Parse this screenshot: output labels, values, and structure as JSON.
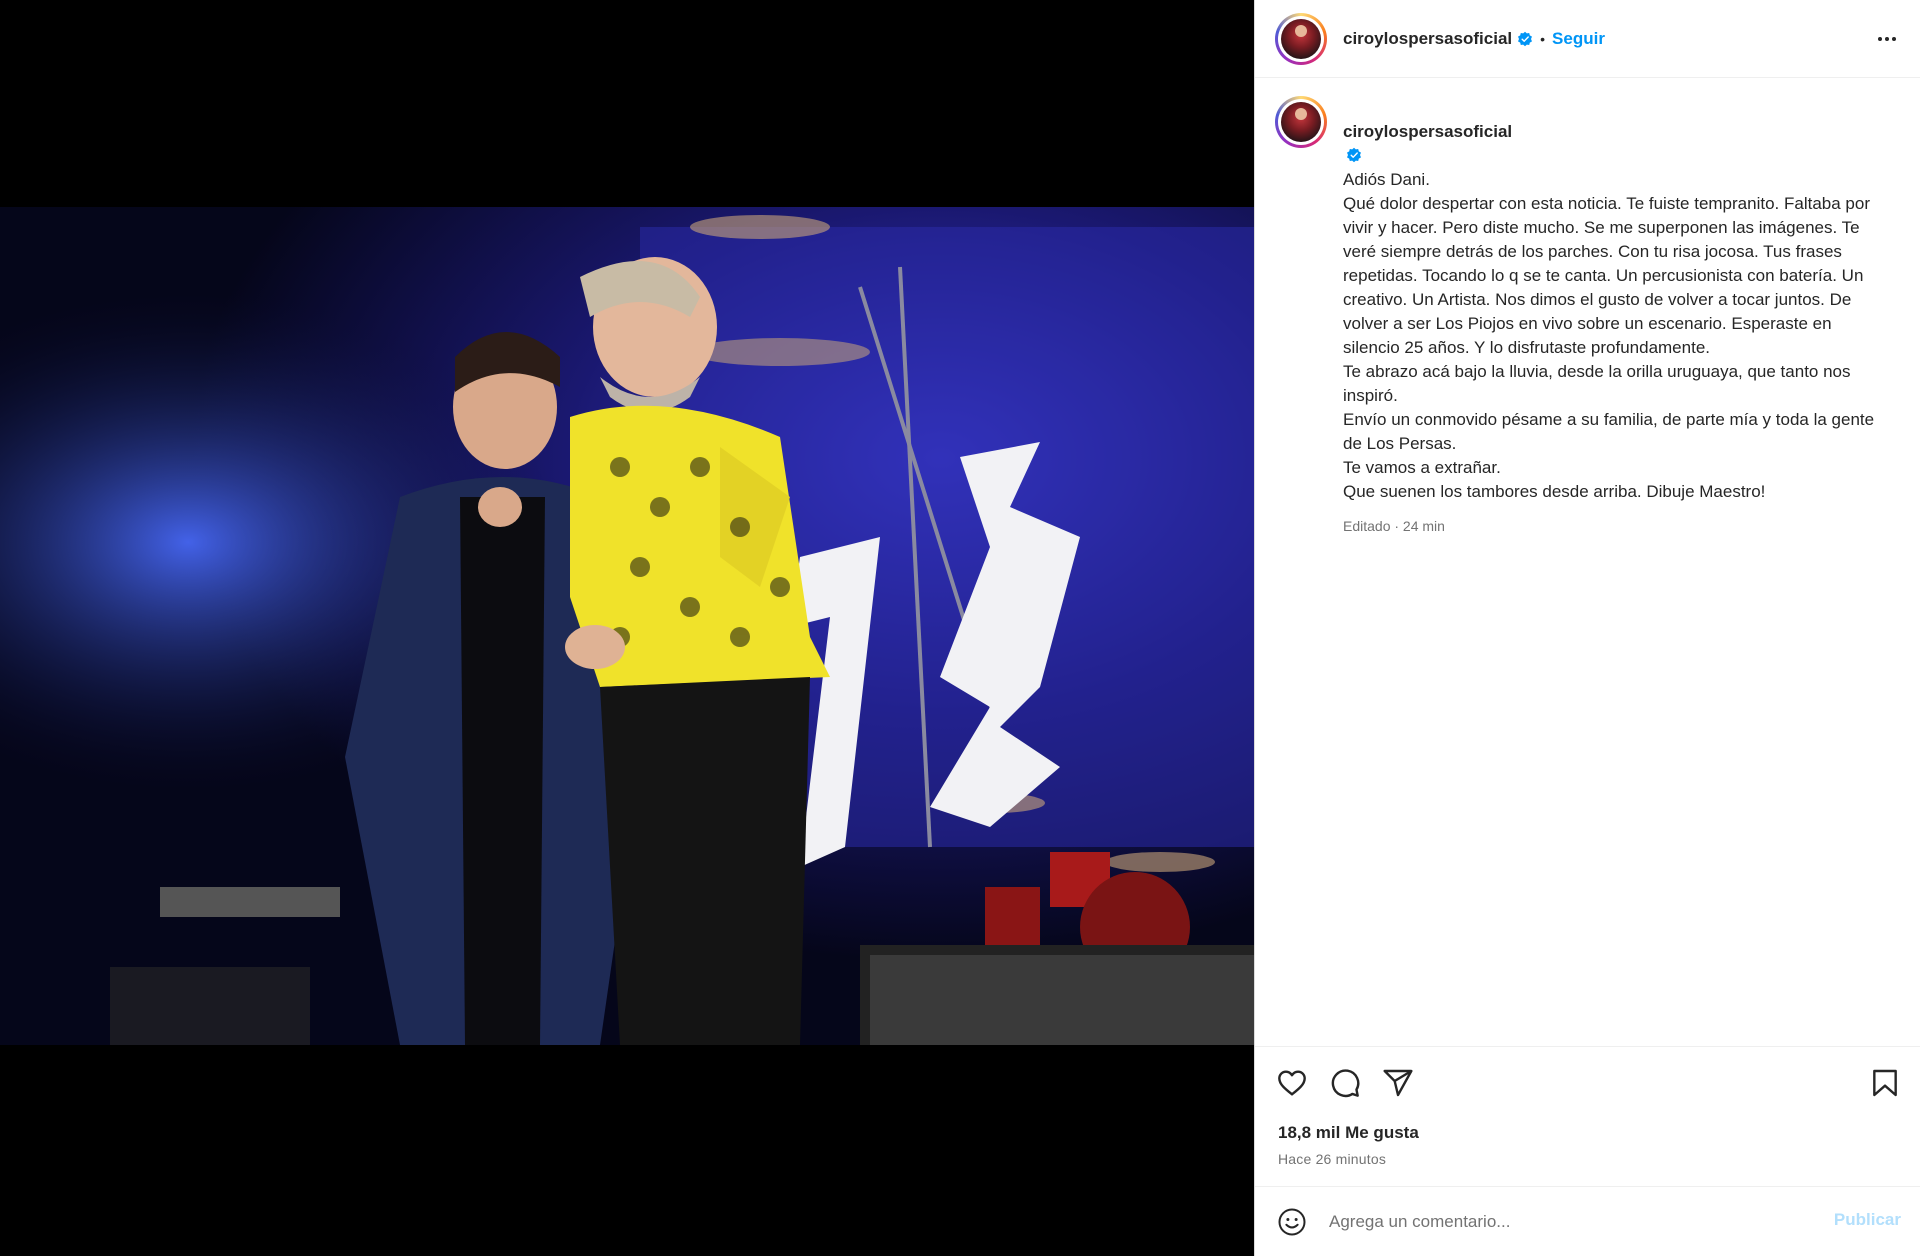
{
  "post": {
    "username": "ciroylospersasoficial",
    "follow_label": "Seguir",
    "separator": "•"
  },
  "caption": {
    "username": "ciroylospersasoficial",
    "text": "Adiós Dani.\nQué dolor despertar con esta noticia. Te fuiste tempranito. Faltaba por vivir y hacer. Pero diste mucho. Se me superponen las imágenes. Te veré siempre detrás de los parches. Con tu risa jocosa. Tus frases repetidas. Tocando lo q se te canta. Un percusionista con batería. Un creativo. Un Artista. Nos dimos el gusto de volver a tocar juntos. De volver a ser Los Piojos en vivo sobre un escenario. Esperaste en silencio 25 años. Y lo disfrutaste profundamente.\nTe abrazo acá bajo la lluvia, desde la orilla uruguaya, que tanto nos inspiró.\nEnvío un conmovido pésame a su familia, de parte mía y toda la gente de Los Persas.\nTe vamos a extrañar.\nQue suenen los tambores desde arriba. Dibuje Maestro!",
    "meta": "Editado · 24 min"
  },
  "stats": {
    "likes": "18,8 mil Me gusta",
    "time": "Hace 26 minutos"
  },
  "comment": {
    "placeholder": "Agrega un comentario...",
    "publish_label": "Publicar"
  },
  "icons": {
    "more": "more-options-icon",
    "like": "heart-icon",
    "comment": "comment-icon",
    "share": "share-icon",
    "save": "bookmark-icon",
    "emoji": "emoji-icon",
    "verified": "verified-badge-icon"
  },
  "colors": {
    "accent": "#0095f6",
    "publish_disabled": "#b2dffc",
    "text": "#262626",
    "muted": "#737373"
  }
}
